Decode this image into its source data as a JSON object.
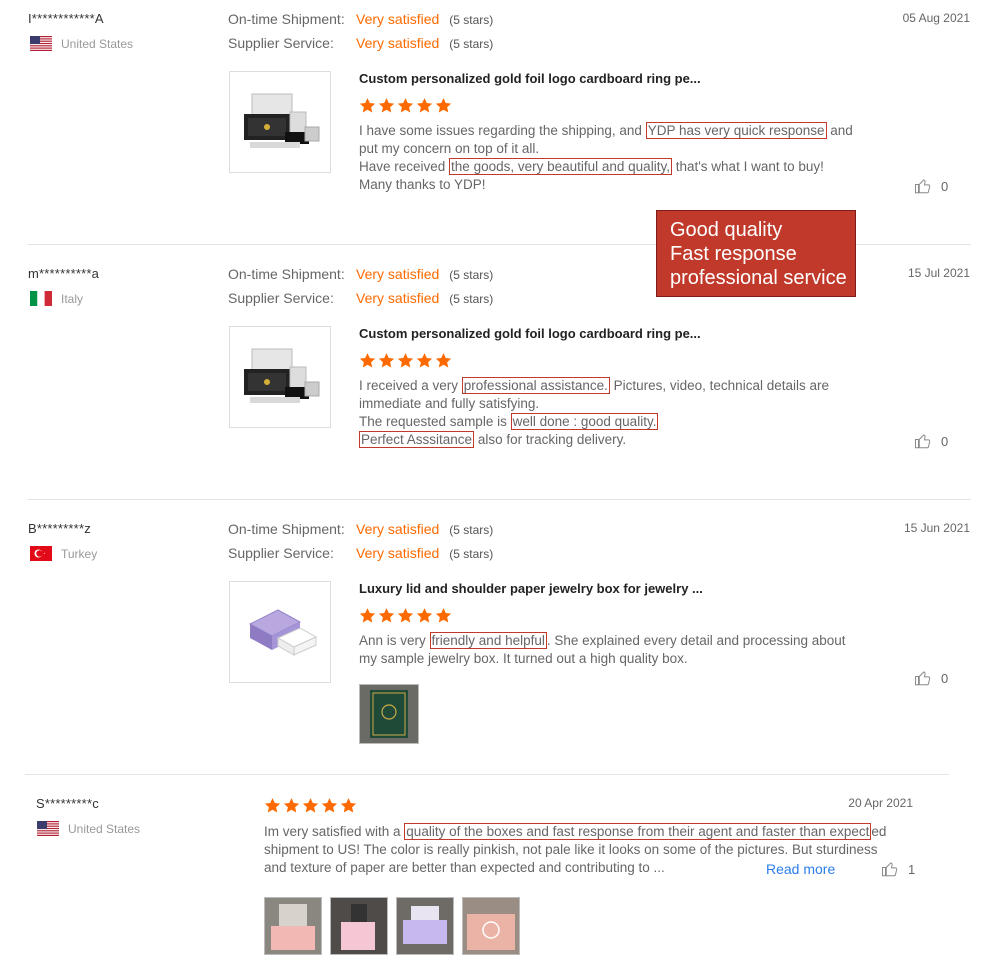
{
  "labels": {
    "shipment": "On-time Shipment:",
    "service": "Supplier Service:",
    "read_more": "Read more"
  },
  "badge": {
    "line1": "Good quality",
    "line2": "Fast response",
    "line3": "professional service"
  },
  "reviews": [
    {
      "user": "I************A",
      "country": "United States",
      "flag": "us",
      "date": "05 Aug 2021",
      "shipment": "Very satisfied",
      "shipment_stars": "(5 stars)",
      "service": "Very satisfied",
      "service_stars": "(5 stars)",
      "product_title": "Custom personalized gold foil logo cardboard ring pe...",
      "rating": 5,
      "text": {
        "p1": "I have some issues regarding the shipping, and ",
        "h1": "YDP has very quick response",
        "p2": " and put my concern on top of it all.",
        "p3": "Have received ",
        "h2": "the goods, very beautiful and quality,",
        "p4": " that's what I want to buy! Many thanks to YDP!"
      },
      "likes": "0"
    },
    {
      "user": "m**********a",
      "country": "Italy",
      "flag": "it",
      "date": "15 Jul 2021",
      "shipment": "Very satisfied",
      "shipment_stars": "(5 stars)",
      "service": "Very satisfied",
      "service_stars": "(5 stars)",
      "product_title": "Custom personalized gold foil logo cardboard ring pe...",
      "rating": 5,
      "text": {
        "p1": "I received a very ",
        "h1": "professional assistance.",
        "p2": " Pictures, video, technical details are immediate and fully satisfying.",
        "p3": "The requested sample is ",
        "h2": "well done : good quality.",
        "h3": "Perfect Asssitance",
        "p4": " also for tracking delivery."
      },
      "likes": "0"
    },
    {
      "user": "B*********z",
      "country": "Turkey",
      "flag": "tr",
      "date": "15 Jun 2021",
      "shipment": "Very satisfied",
      "shipment_stars": "(5 stars)",
      "service": "Very satisfied",
      "service_stars": "(5 stars)",
      "product_title": "Luxury lid and shoulder paper jewelry box for jewelry ...",
      "rating": 5,
      "text": {
        "p1": "Ann is very ",
        "h1": "friendly and helpful",
        "p2": ". She explained every detail and processing about my sample jewelry box. It turned out a high quality box."
      },
      "likes": "0"
    },
    {
      "user": "S*********c",
      "country": "United States",
      "flag": "us",
      "date": "20 Apr 2021",
      "rating": 5,
      "text": {
        "p1": "Im very satisfied with a ",
        "h1": "quality of the boxes and fast response from their agent and faster than expect",
        "p2": "ed shipment to US! The color is really pinkish, not pale like it looks on some of the pictures. But sturdiness and texture of paper are better than expected and contributing to ..."
      },
      "likes": "1"
    }
  ],
  "colors": {
    "accent": "#ff6a00",
    "highlight_border": "#c0392b",
    "badge_bg": "#c0392b",
    "link": "#2b7de9"
  }
}
